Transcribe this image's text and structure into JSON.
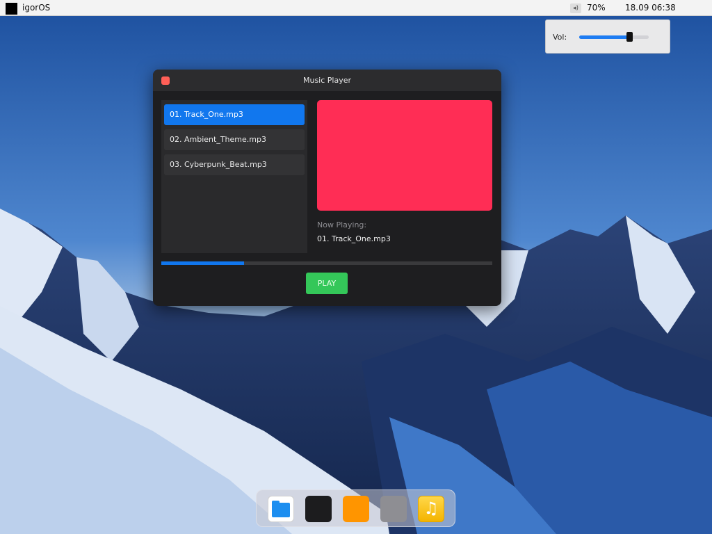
{
  "menubar": {
    "os_name": "igorOS",
    "volume_percent_label": "70%",
    "clock": "18.09 06:38",
    "volume_icon": "speaker-icon"
  },
  "volume_popup": {
    "label": "Vol:",
    "level": 0.72
  },
  "window": {
    "title": "Music Player",
    "close_color": "#ff5f57"
  },
  "playlist": {
    "items": [
      {
        "label": "01. Track_One.mp3",
        "active": true
      },
      {
        "label": "02. Ambient_Theme.mp3",
        "active": false
      },
      {
        "label": "03. Cyberpunk_Beat.mp3",
        "active": false
      }
    ]
  },
  "now_playing": {
    "label": "Now Playing:",
    "track": "01. Track_One.mp3",
    "art_color": "#ff2d55"
  },
  "progress": {
    "fraction": 0.25
  },
  "controls": {
    "play_label": "PLAY",
    "play_color": "#34c759"
  },
  "dock": {
    "items": [
      {
        "name": "files",
        "icon": "folder-icon"
      },
      {
        "name": "terminal",
        "icon": "terminal-icon"
      },
      {
        "name": "orange-app",
        "icon": "orange-app-icon"
      },
      {
        "name": "gray-app",
        "icon": "gray-app-icon"
      },
      {
        "name": "music",
        "icon": "music-note-icon"
      }
    ]
  },
  "colors": {
    "accent": "#1177ee",
    "window_bg": "#1e1e20"
  }
}
